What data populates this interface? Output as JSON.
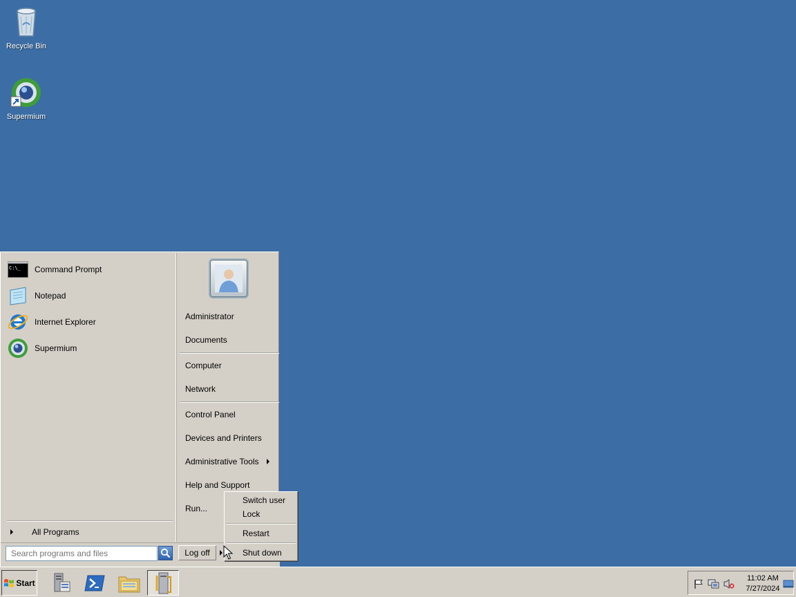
{
  "desktop": {
    "icons": [
      {
        "label": "Recycle Bin",
        "icon": "recycle-bin-icon"
      },
      {
        "label": "Supermium",
        "icon": "supermium-shortcut-icon"
      }
    ]
  },
  "start_menu": {
    "programs": [
      {
        "label": "Command Prompt",
        "icon": "command-prompt-icon"
      },
      {
        "label": "Notepad",
        "icon": "notepad-icon"
      },
      {
        "label": "Internet Explorer",
        "icon": "internet-explorer-icon"
      },
      {
        "label": "Supermium",
        "icon": "supermium-icon"
      }
    ],
    "all_programs": "All Programs",
    "search_placeholder": "Search programs and files",
    "logoff": "Log off",
    "right_items": [
      {
        "label": "Administrator"
      },
      {
        "label": "Documents"
      },
      {
        "label": "Computer"
      },
      {
        "label": "Network"
      },
      {
        "label": "Control Panel"
      },
      {
        "label": "Devices and Printers"
      },
      {
        "label": "Administrative Tools",
        "has_submenu": true
      },
      {
        "label": "Help and Support"
      },
      {
        "label": "Run..."
      }
    ],
    "shutdown_submenu": [
      {
        "label": "Switch user"
      },
      {
        "label": "Lock"
      },
      {
        "label": "Restart"
      },
      {
        "label": "Shut down"
      }
    ]
  },
  "taskbar": {
    "start_label": "Start",
    "pinned": [
      {
        "icon": "server-manager-icon"
      },
      {
        "icon": "powershell-icon"
      },
      {
        "icon": "windows-explorer-icon"
      },
      {
        "icon": "admin-tools-icon",
        "active": true
      }
    ],
    "tray": {
      "icons": [
        "action-center-flag-icon",
        "network-icon",
        "volume-muted-icon"
      ],
      "time": "11:02 AM",
      "date": "7/27/2024"
    }
  },
  "colors": {
    "desktop": "#3c6ea5",
    "menu_bg": "#d4d0c8"
  }
}
